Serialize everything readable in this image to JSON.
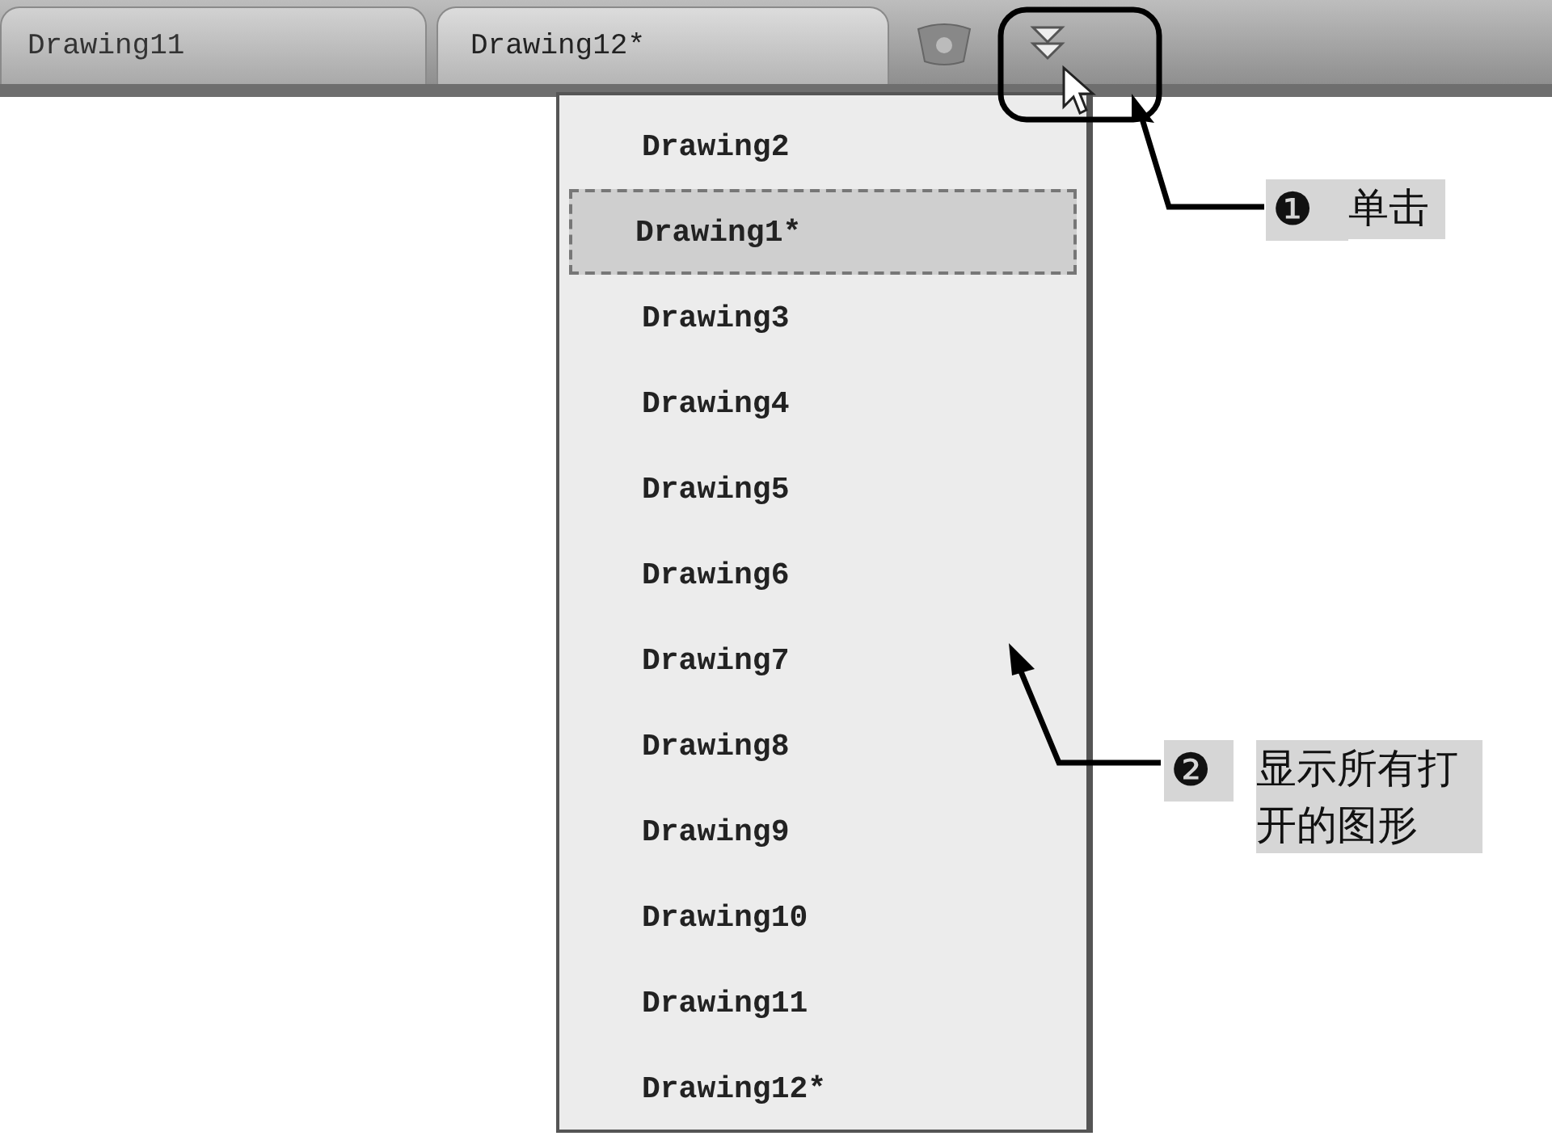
{
  "tabs": [
    {
      "label": "Drawing11",
      "selected": false
    },
    {
      "label": "Drawing12*",
      "selected": true
    }
  ],
  "menu": {
    "items": [
      {
        "label": "Drawing2",
        "selected": false
      },
      {
        "label": "Drawing1*",
        "selected": true
      },
      {
        "label": "Drawing3",
        "selected": false
      },
      {
        "label": "Drawing4",
        "selected": false
      },
      {
        "label": "Drawing5",
        "selected": false
      },
      {
        "label": "Drawing6",
        "selected": false
      },
      {
        "label": "Drawing7",
        "selected": false
      },
      {
        "label": "Drawing8",
        "selected": false
      },
      {
        "label": "Drawing9",
        "selected": false
      },
      {
        "label": "Drawing10",
        "selected": false
      },
      {
        "label": "Drawing11",
        "selected": false
      },
      {
        "label": "Drawing12*",
        "selected": false
      }
    ]
  },
  "callouts": [
    {
      "number": "❶",
      "text": "单击"
    },
    {
      "number": "❷",
      "text": "显示所有打开的图形"
    }
  ]
}
